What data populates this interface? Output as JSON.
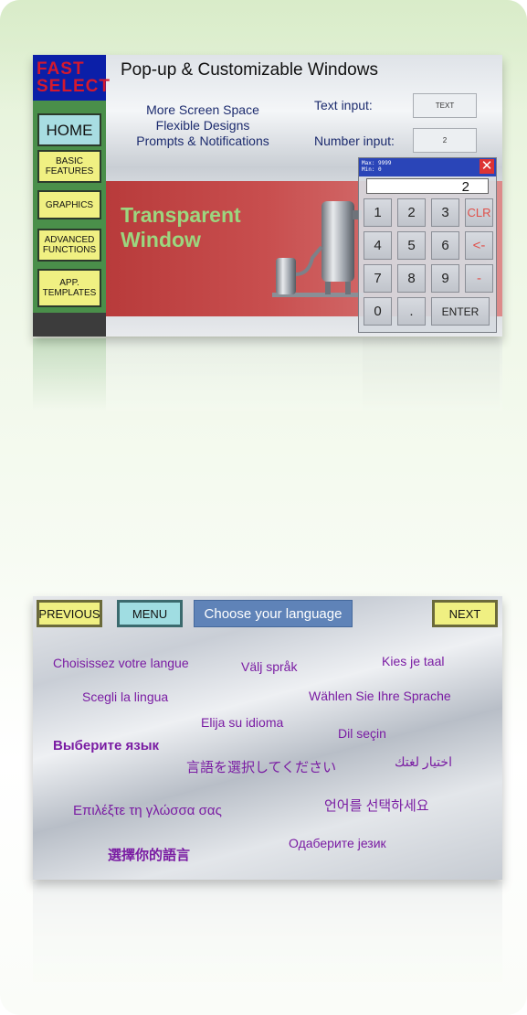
{
  "panel1": {
    "brand": [
      "FAST",
      "SELECT"
    ],
    "sidebar": [
      {
        "label": "HOME"
      },
      {
        "label": "BASIC FEATURES"
      },
      {
        "label": "GRAPHICS"
      },
      {
        "label": "ADVANCED FUNCTIONS"
      },
      {
        "label": "APP. TEMPLATES"
      }
    ],
    "title": "Pop-up & Customizable Windows",
    "features": [
      "More Screen Space",
      "Flexible Designs",
      "Prompts & Notifications"
    ],
    "text_input": {
      "label": "Text input:",
      "value": "TEXT"
    },
    "number_input": {
      "label": "Number input:",
      "value": "2"
    },
    "transparent_title": [
      "Transparent",
      "Window"
    ],
    "keypad": {
      "max": "Max: 9999",
      "min": "Min: 0",
      "close": "✕",
      "display": "2",
      "keys": [
        "1",
        "2",
        "3",
        "CLR",
        "4",
        "5",
        "6",
        "<-",
        "7",
        "8",
        "9",
        "-",
        "0",
        ".",
        "ENTER"
      ]
    }
  },
  "panel2": {
    "previous": "PREVIOUS",
    "menu": "MENU",
    "title": "Choose your language",
    "next": "NEXT",
    "languages": [
      "Choisissez votre langue",
      "Välj språk",
      "Kies je taal",
      "Scegli la lingua",
      "Wählen Sie Ihre Sprache",
      "Elija su idioma",
      "Dil seçin",
      "Выберите язык",
      "言語を選択してください",
      "اختيار لغتك",
      "Επιλέξτε τη γλώσσα σας",
      "언어를 선택하세요",
      "選擇你的語言",
      "Одаберите језик"
    ]
  },
  "colors": {
    "sidebar_green": "#4a8f4a",
    "brand_red": "#d4192e",
    "keypad_header": "#2a45b8",
    "language_text": "#7a1ca3",
    "title_blue": "#5f83b8"
  }
}
